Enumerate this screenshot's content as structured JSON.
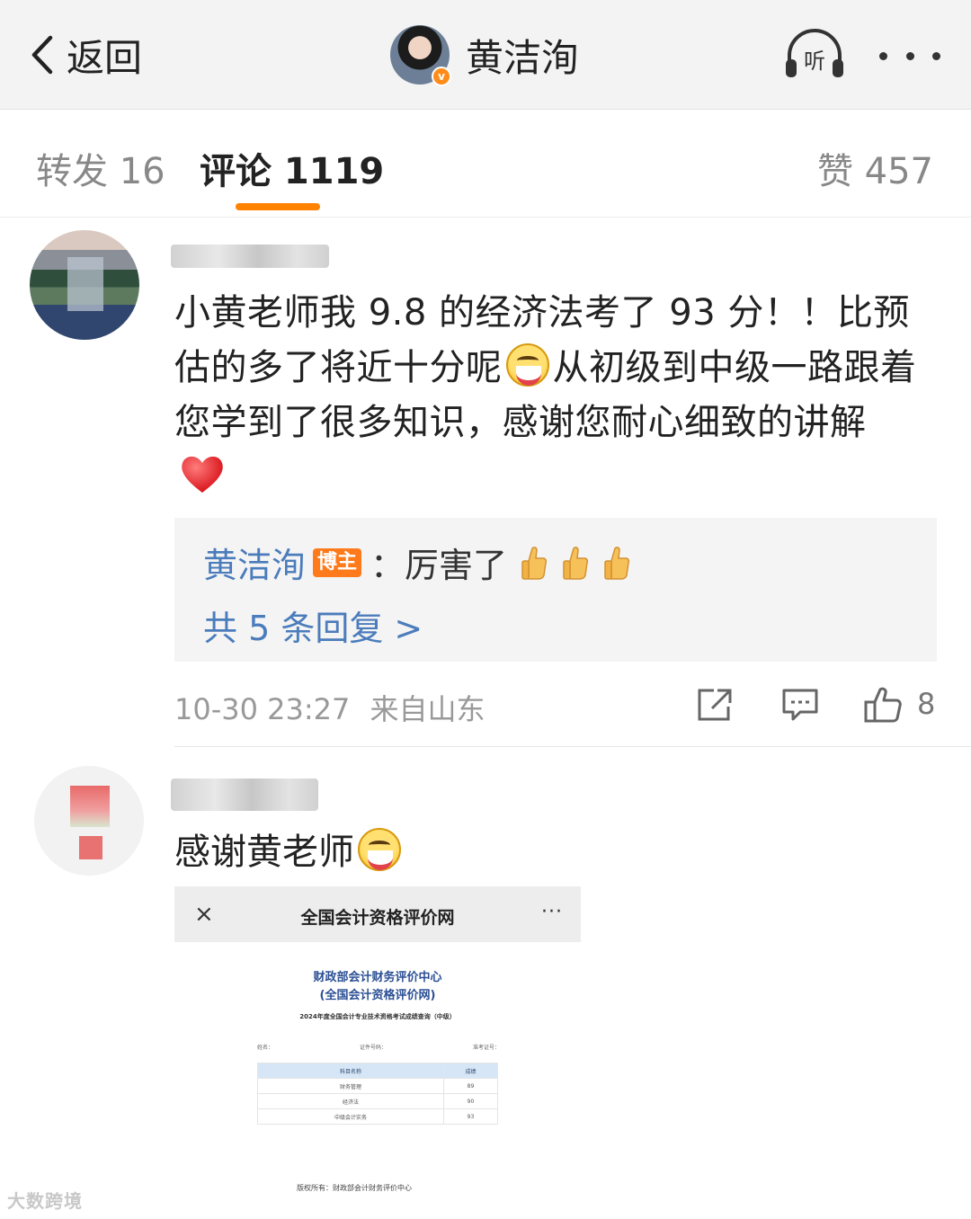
{
  "topbar": {
    "back_label": "返回",
    "author_name": "黄洁洵",
    "listen_label": "听"
  },
  "tabs": {
    "repost": "转发 16",
    "comments": "评论 1119",
    "likes": "赞 457"
  },
  "comments": [
    {
      "text": "小黄老师我 9.8 的经济法考了 93 分！！比预估的多了将近十分呢",
      "text_after_emoji": "从初级到中级一路跟着您学到了很多知识，感谢您耐心细致的讲解",
      "reply": {
        "author": "黄洁洵",
        "tag": "博主",
        "text": "：厉害了",
        "more": "共 5 条回复 >"
      },
      "time": "10-30 23:27",
      "location": "来自山东",
      "like_count": "8"
    },
    {
      "text": "感谢黄老师",
      "image": {
        "title": "全国会计资格评价网",
        "close": "×",
        "more": "···",
        "org_line1": "财政部会计财务评价中心",
        "org_line2": "(全国会计资格评价网)",
        "subtitle": "2024年度全国会计专业技术资格考试成绩查询（中级）",
        "info_name": "姓名：",
        "info_id": "证件号码：",
        "info_ticket": "准考证号：",
        "table_header": [
          "科目名称",
          "成绩"
        ],
        "rows": [
          [
            "财务管理",
            "89"
          ],
          [
            "经济法",
            "90"
          ],
          [
            "中级会计实务",
            "93"
          ]
        ],
        "footer": "版权所有：财政部会计财务评价中心"
      }
    }
  ],
  "watermark": "大数跨境",
  "colors": {
    "accent": "#ff8200",
    "link": "#4b7cbb",
    "blogger_tag": "#ff7a1a",
    "muted": "#999999"
  },
  "icons": [
    "back-chevron-icon",
    "listen-icon",
    "more-icon",
    "heart-emoji-icon",
    "laugh-emoji-icon",
    "thumbs-up-emoji-icon",
    "share-icon",
    "comment-icon",
    "like-icon"
  ]
}
